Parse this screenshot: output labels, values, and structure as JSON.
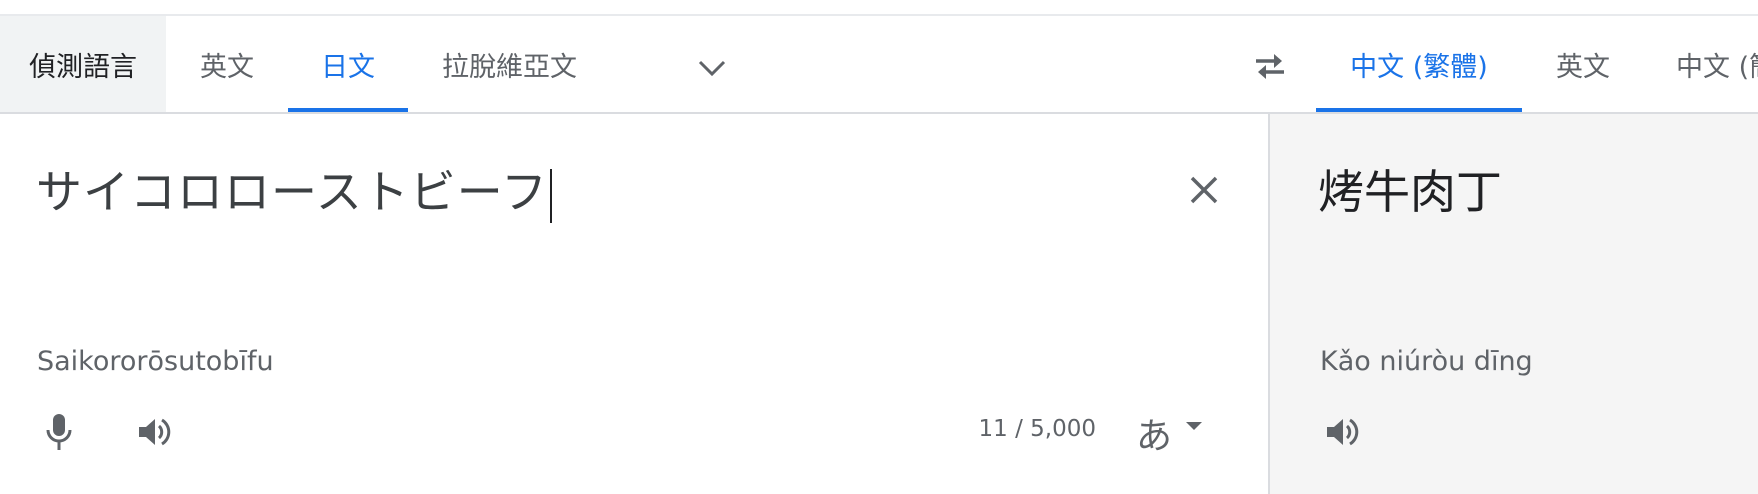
{
  "source_tabs": {
    "detect": "偵測語言",
    "english": "英文",
    "japanese": "日文",
    "latvian": "拉脫維亞文"
  },
  "target_tabs": {
    "zh_hant": "中文 (繁體)",
    "english": "英文",
    "zh_hans": "中文 (簡"
  },
  "source": {
    "text": "サイコロローストビーフ",
    "transliteration": "Saikororōsutobīfu",
    "char_count": "11 / 5,000",
    "ime_label": "あ"
  },
  "target": {
    "text": "烤牛肉丁",
    "transliteration": "Kǎo niúròu dīng"
  },
  "icons": {
    "more_languages": "chevron-down-icon",
    "swap": "swap-icon",
    "clear": "close-icon",
    "mic": "mic-icon",
    "speaker": "speaker-icon"
  },
  "colors": {
    "accent": "#1a73e8",
    "text": "#3c4043",
    "muted": "#5f6368",
    "output_bg": "#f5f5f5"
  }
}
